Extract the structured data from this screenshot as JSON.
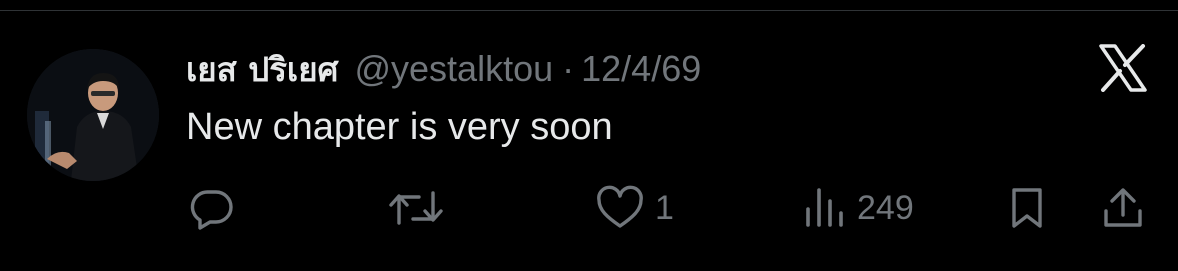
{
  "tweet": {
    "display_name": "เยส ปริเยศ",
    "handle": "@yestalktou",
    "separator": "·",
    "date": "12/4/69",
    "text": "New chapter is very soon"
  },
  "actions": {
    "likes": "1",
    "views": "249"
  },
  "icons": {
    "brand": "x-logo-icon",
    "reply": "reply-icon",
    "repost": "repost-icon",
    "like": "heart-icon",
    "views": "views-icon",
    "bookmark": "bookmark-icon",
    "share": "share-icon"
  },
  "colors": {
    "background": "#000000",
    "primary_text": "#e7e9ea",
    "secondary_text": "#71767b",
    "divider": "#2f3336"
  }
}
